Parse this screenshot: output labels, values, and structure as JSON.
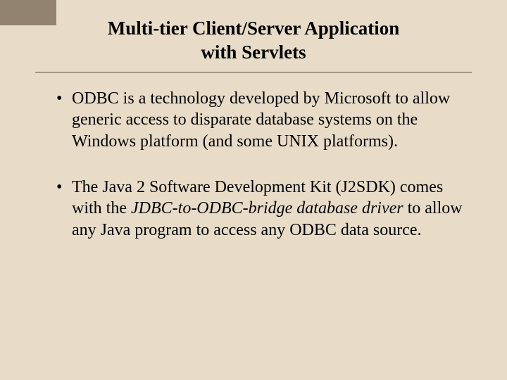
{
  "title_line1": "Multi-tier Client/Server Application",
  "title_line2": "with Servlets",
  "bullets": [
    {
      "pre": "ODBC is a technology developed by Microsoft to allow generic access to disparate database systems on the Windows platform (and some UNIX platforms).",
      "italic": "",
      "post": ""
    },
    {
      "pre": "The Java 2 Software Development Kit (J2SDK) comes with the ",
      "italic": "JDBC-to-ODBC-bridge database driver",
      "post": " to allow any Java program to access any ODBC data source."
    }
  ]
}
